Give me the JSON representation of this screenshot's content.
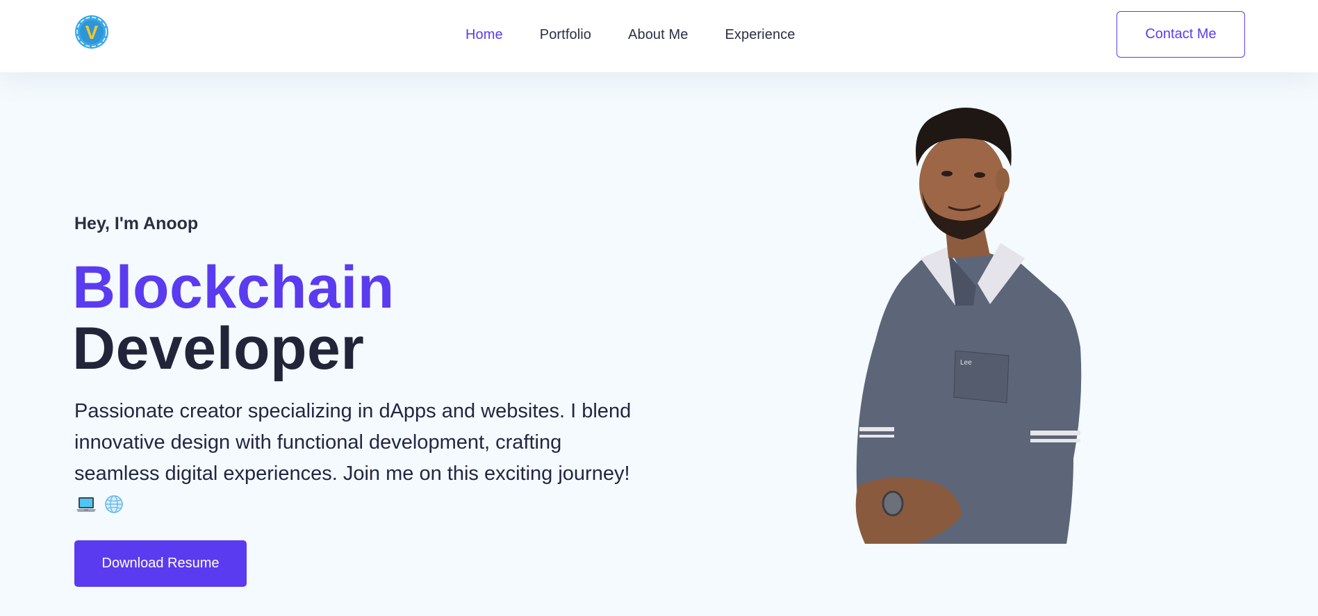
{
  "nav": {
    "logo_letter": "V",
    "links": [
      {
        "label": "Home",
        "active": true
      },
      {
        "label": "Portfolio",
        "active": false
      },
      {
        "label": "About Me",
        "active": false
      },
      {
        "label": "Experience",
        "active": false
      }
    ],
    "contact_label": "Contact Me"
  },
  "hero": {
    "greeting": "Hey, I'm Anoop",
    "title_accent": "Blockchain",
    "title_main": "Developer",
    "description": "Passionate creator specializing in dApps and websites. I blend innovative design with functional development, crafting seamless digital experiences. Join me on this exciting journey!",
    "emoji_icons": [
      "laptop-icon",
      "globe-icon"
    ],
    "download_label": "Download Resume",
    "shirt_badge": "Lee"
  },
  "colors": {
    "accent": "#5b3bf0",
    "dark_text": "#22253a",
    "background": "#f4fafd",
    "nav_background": "#ffffff",
    "logo_ring": "#3aa8e8",
    "logo_letter": "#f5c72b"
  }
}
